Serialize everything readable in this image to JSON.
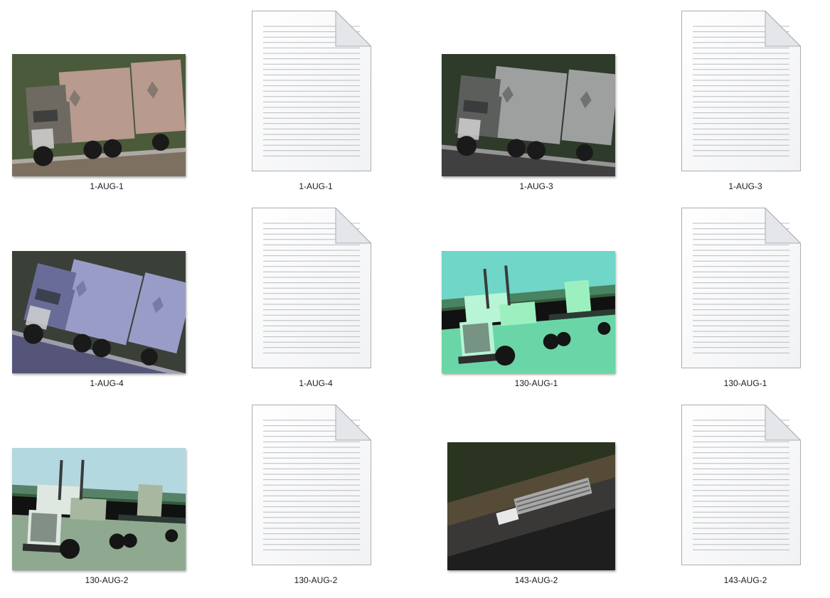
{
  "files": [
    {
      "name": "1-AUG-1",
      "kind": "image",
      "thumb": "truck-ups-photo",
      "tint": {
        "sky": "#4a5a3a",
        "body": "#b89a8e",
        "cab": "#6e6a62",
        "ground": "#7d7060"
      }
    },
    {
      "name": "1-AUG-1",
      "kind": "text-document",
      "icon": "text-file-icon"
    },
    {
      "name": "1-AUG-3",
      "kind": "image",
      "thumb": "truck-ups-photo",
      "tint": {
        "sky": "#2e3a2a",
        "body": "#9ea0a0",
        "cab": "#5c5e5c",
        "ground": "#404040"
      }
    },
    {
      "name": "1-AUG-3",
      "kind": "text-document",
      "icon": "text-file-icon"
    },
    {
      "name": "1-AUG-4",
      "kind": "image",
      "thumb": "truck-ups-photo",
      "tint": {
        "sky": "#3a4038",
        "body": "#9a9cc8",
        "cab": "#6a6c98",
        "ground": "#55557a"
      }
    },
    {
      "name": "1-AUG-4",
      "kind": "text-document",
      "icon": "text-file-icon"
    },
    {
      "name": "130-AUG-1",
      "kind": "image",
      "thumb": "truck-lowboy-photo",
      "tint": {
        "sky": "#6fd6c8",
        "body": "#9cf0c0",
        "cab": "#b8f4d6",
        "ground": "#6ad6a8"
      }
    },
    {
      "name": "130-AUG-1",
      "kind": "text-document",
      "icon": "text-file-icon"
    },
    {
      "name": "130-AUG-2",
      "kind": "image",
      "thumb": "truck-lowboy-photo",
      "tint": {
        "sky": "#b4d8e0",
        "body": "#a8b8a0",
        "cab": "#dfe8e0",
        "ground": "#8fa890"
      }
    },
    {
      "name": "130-AUG-2",
      "kind": "text-document",
      "icon": "text-file-icon"
    },
    {
      "name": "143-AUG-2",
      "kind": "image",
      "thumb": "truck-aerial-photo",
      "tint": {
        "sky": "#2a3420",
        "body": "#a8a8a8",
        "cab": "#e8e8e8",
        "ground": "#3a3836"
      }
    },
    {
      "name": "143-AUG-2",
      "kind": "text-document",
      "icon": "text-file-icon"
    }
  ]
}
